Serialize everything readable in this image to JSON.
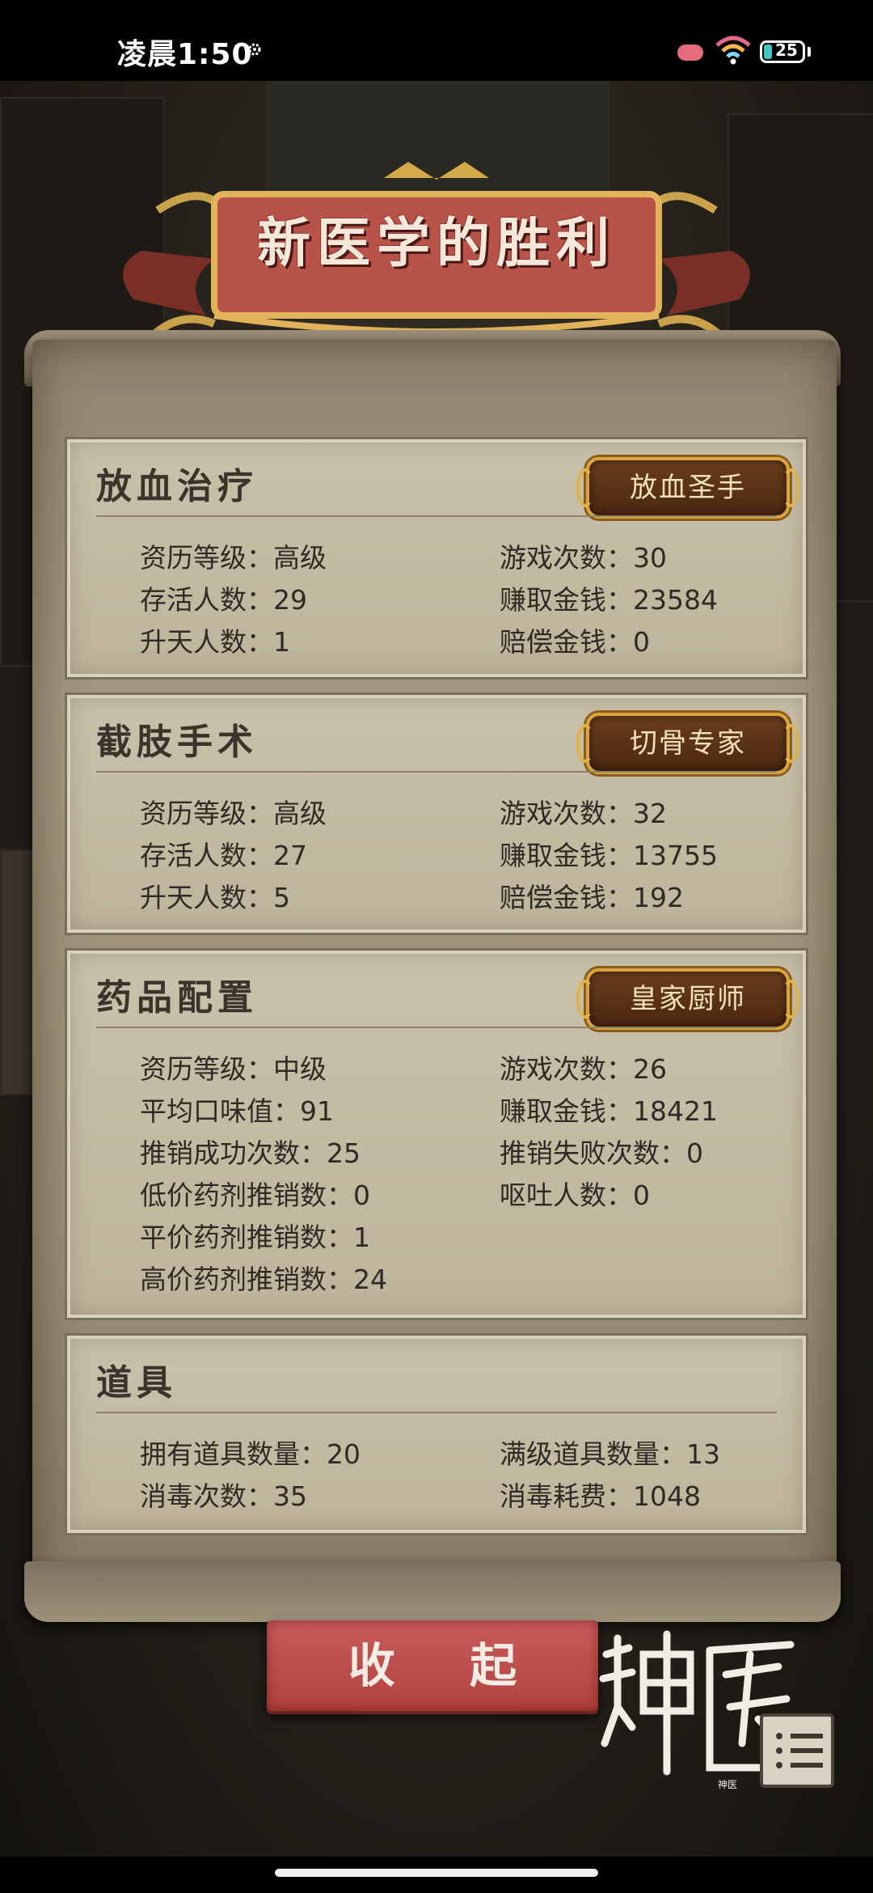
{
  "status_bar": {
    "time": "凌晨1:50",
    "battery": "25"
  },
  "title": "新医学的胜利",
  "sections": [
    {
      "title": "放血治疗",
      "badge": "放血圣手",
      "stats_left": [
        "资历等级：高级",
        "存活人数：29",
        "升天人数：1"
      ],
      "stats_right": [
        "游戏次数：30",
        "赚取金钱：23584",
        "赔偿金钱：0"
      ]
    },
    {
      "title": "截肢手术",
      "badge": "切骨专家",
      "stats_left": [
        "资历等级：高级",
        "存活人数：27",
        "升天人数：5"
      ],
      "stats_right": [
        "游戏次数：32",
        "赚取金钱：13755",
        "赔偿金钱：192"
      ]
    },
    {
      "title": "药品配置",
      "badge": "皇家厨师",
      "stats_left": [
        "资历等级：中级",
        "平均口味值：91",
        "推销成功次数：25",
        "低价药剂推销数：0",
        "平价药剂推销数：1",
        "高价药剂推销数：24"
      ],
      "stats_right": [
        "游戏次数：26",
        "赚取金钱：18421",
        "推销失败次数：0",
        "呕吐人数：0"
      ]
    },
    {
      "title": "道具",
      "stats_left": [
        "拥有道具数量：20",
        "消毒次数：35"
      ],
      "stats_right": [
        "满级道具数量：13",
        "消毒耗费：1048"
      ]
    }
  ],
  "collapse_button": "收 起",
  "logo_text": "神医",
  "colors": {
    "banner_red": "#b8534a",
    "badge_gold": "#d9a53b",
    "parchment": "#c8c0a8",
    "button_red": "#b94a47"
  }
}
